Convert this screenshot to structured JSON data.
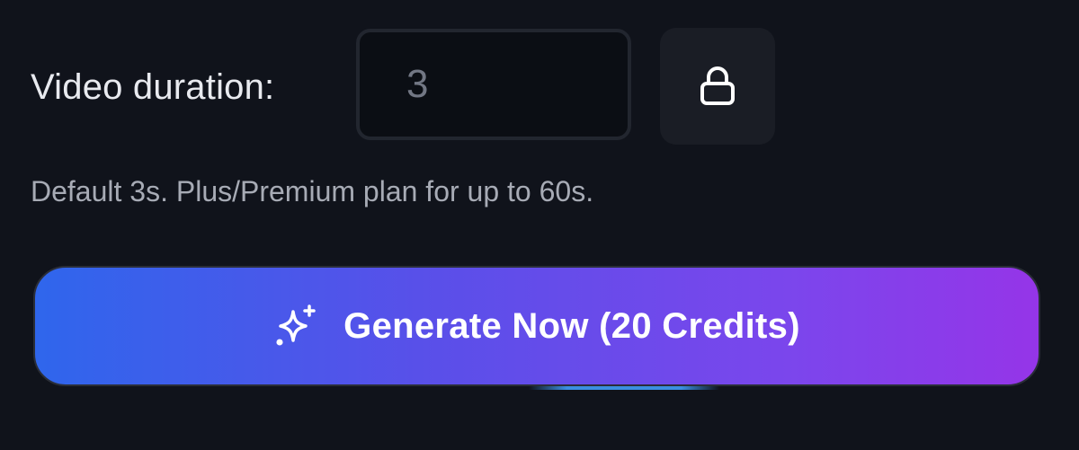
{
  "duration": {
    "label": "Video duration:",
    "placeholder": "3",
    "value": ""
  },
  "lock": {
    "icon": "lock-icon",
    "locked": true
  },
  "hint": "Default 3s. Plus/Premium plan for up to 60s.",
  "generate": {
    "label": "Generate Now (20 Credits)",
    "icon": "sparkle-icon",
    "gradient_start": "#2f66ec",
    "gradient_end": "#9535e8"
  },
  "colors": {
    "background": "#10131b",
    "accent_line": "#3b8fe0"
  }
}
